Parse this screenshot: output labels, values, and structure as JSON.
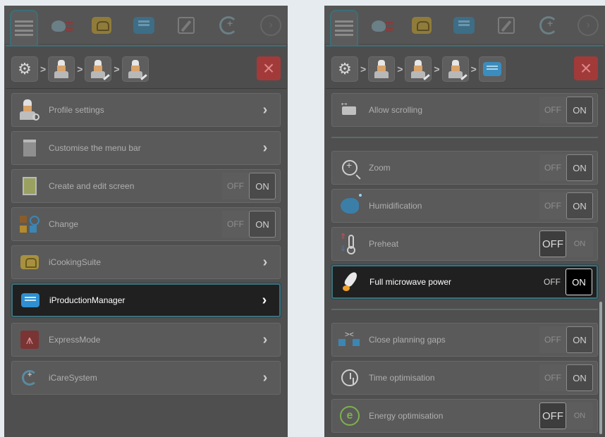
{
  "left": {
    "toolbar": {
      "icons": [
        "menu-icon",
        "wash-icon",
        "icookingsuite-icon",
        "iproductionmanager-icon",
        "edit-icon",
        "icaresystem-icon",
        "next-icon"
      ]
    },
    "breadcrumb": [
      "gear-icon",
      "chef-icon",
      "chef-edit-icon",
      "chef-edit-icon"
    ],
    "close_symbol": "×",
    "rows": [
      {
        "label": "Profile settings",
        "type": "chevron",
        "icon": "profile-settings-icon"
      },
      {
        "label": "Customise the menu bar",
        "type": "chevron",
        "icon": "menu-bar-icon"
      },
      {
        "label": "Create and edit screen",
        "type": "toggle",
        "state": "on",
        "icon": "create-edit-icon"
      },
      {
        "label": "Change",
        "type": "toggle",
        "state": "on",
        "icon": "change-icon"
      },
      {
        "label": "iCookingSuite",
        "type": "chevron",
        "icon": "icookingsuite-icon"
      },
      {
        "label": "iProductionManager",
        "type": "chevron",
        "selected": true,
        "icon": "iproductionmanager-icon"
      },
      {
        "label": "ExpressMode",
        "type": "chevron",
        "icon": "expressmode-icon"
      },
      {
        "label": "iCareSystem",
        "type": "chevron",
        "icon": "icaresystem-icon"
      }
    ]
  },
  "right": {
    "breadcrumb": [
      "gear-icon",
      "chef-icon",
      "chef-edit-icon",
      "chef-edit-icon",
      "iproductionmanager-icon"
    ],
    "close_symbol": "×",
    "rows": [
      {
        "label": "Allow scrolling",
        "state": "on",
        "icon": "scroll-icon"
      },
      {
        "label": "Zoom",
        "state": "on",
        "icon": "zoom-icon"
      },
      {
        "label": "Humidification",
        "state": "on",
        "icon": "humidification-icon"
      },
      {
        "label": "Preheat",
        "state": "off",
        "icon": "preheat-icon"
      },
      {
        "label": "Full microwave power",
        "state": "on",
        "selected": true,
        "icon": "rocket-icon"
      },
      {
        "label": "Close planning gaps",
        "state": "on",
        "icon": "close-gaps-icon"
      },
      {
        "label": "Time optimisation",
        "state": "on",
        "icon": "time-optimisation-icon"
      },
      {
        "label": "Energy optimisation",
        "state": "off",
        "icon": "energy-optimisation-icon"
      }
    ]
  },
  "toggle": {
    "off_label": "OFF",
    "on_label": "ON"
  },
  "chevron": "›",
  "gear_glyph": "⚙",
  "energy_glyph": "e",
  "express_glyph": "⩚",
  "next_glyph": "›"
}
